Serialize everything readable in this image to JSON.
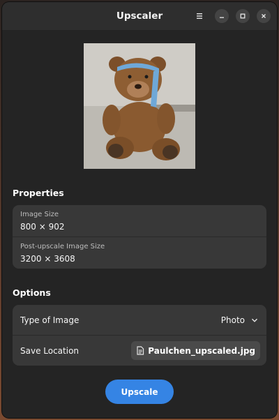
{
  "window": {
    "title": "Upscaler"
  },
  "titlebar": {
    "menu_icon": "hamburger-menu-icon",
    "minimize_icon": "minimize-icon",
    "maximize_icon": "maximize-icon",
    "close_icon": "close-icon"
  },
  "properties": {
    "heading": "Properties",
    "image_size_label": "Image Size",
    "image_size_value": "800 × 902",
    "post_size_label": "Post-upscale Image Size",
    "post_size_value": "3200 × 3608"
  },
  "options": {
    "heading": "Options",
    "type_label": "Type of Image",
    "type_value": "Photo",
    "save_label": "Save Location",
    "save_value": "Paulchen_upscaled.jpg"
  },
  "actions": {
    "upscale_label": "Upscale"
  },
  "colors": {
    "accent": "#3584e4",
    "window_bg": "#242424",
    "card_bg": "#383838"
  }
}
